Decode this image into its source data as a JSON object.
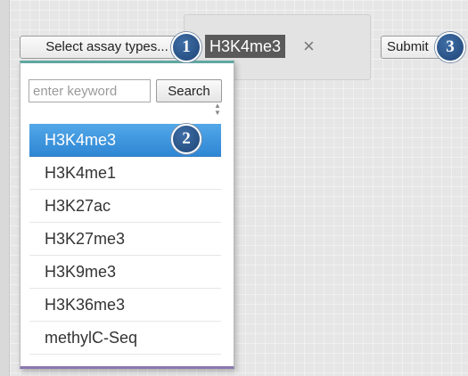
{
  "select_button": {
    "label": "Select assay types..."
  },
  "selected_chip": {
    "label": "H3K4me3",
    "remove": "×"
  },
  "submit_button": {
    "label": "Submit"
  },
  "dropdown": {
    "search": {
      "placeholder": "enter keyword",
      "button_label": "Search"
    },
    "sort_icon": "sort-arrows-icon",
    "selected_index": 0,
    "options": [
      "H3K4me3",
      "H3K4me1",
      "H3K27ac",
      "H3K27me3",
      "H3K9me3",
      "H3K36me3",
      "methylC-Seq"
    ]
  },
  "badges": [
    "1",
    "2",
    "3"
  ],
  "colors": {
    "selected_bg": "#3a93dc",
    "chip_bg": "#5a5a5a",
    "badge_bg": "#2a5a96",
    "dropdown_top_border": "#5fa8a0",
    "dropdown_bottom_border": "#8a78b0"
  }
}
